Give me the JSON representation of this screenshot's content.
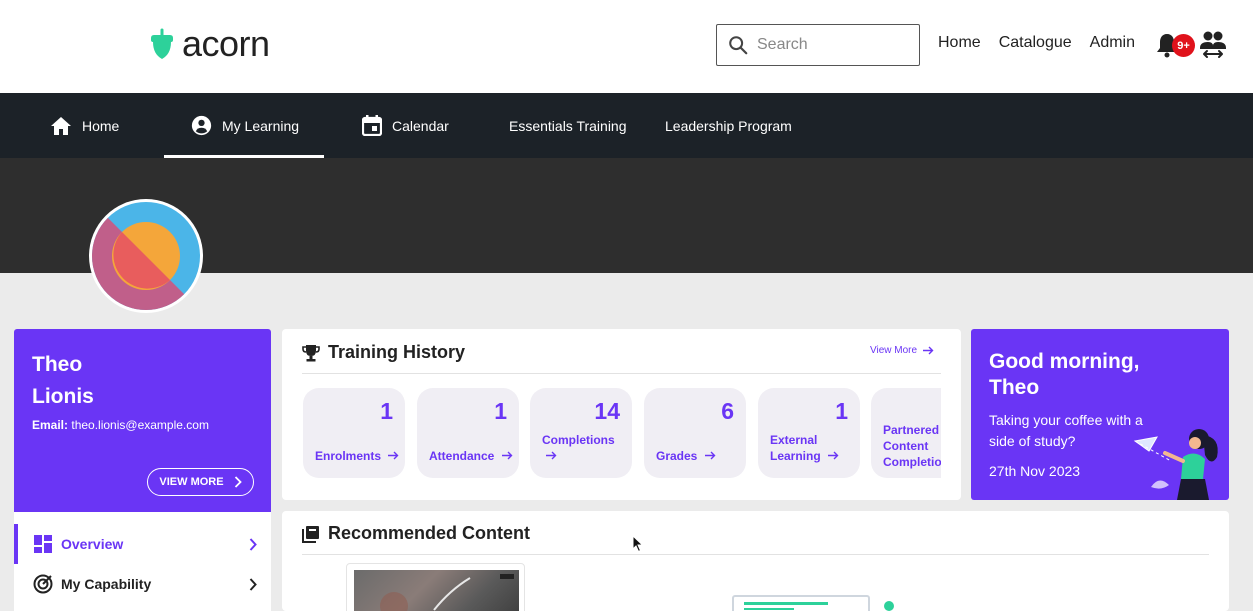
{
  "header": {
    "logo_text": "acorn",
    "search_placeholder": "Search",
    "links": [
      "Home",
      "Catalogue",
      "Admin"
    ],
    "notification_badge": "9+"
  },
  "nav": {
    "items": [
      {
        "label": "Home",
        "icon": "home-icon"
      },
      {
        "label": "My Learning",
        "icon": "account-circle-icon",
        "active": true
      },
      {
        "label": "Calendar",
        "icon": "calendar-icon"
      },
      {
        "label": "Essentials Training"
      },
      {
        "label": "Leadership Program"
      }
    ]
  },
  "profile": {
    "first_name": "Theo",
    "last_name": "Lionis",
    "email_label": "Email:",
    "email": "theo.lionis@example.com",
    "view_more_label": "VIEW MORE"
  },
  "side_menu": {
    "items": [
      {
        "label": "Overview",
        "icon": "dashboard-icon",
        "active": true
      },
      {
        "label": "My Capability",
        "icon": "target-icon"
      }
    ]
  },
  "training_history": {
    "title": "Training History",
    "view_more": "View More",
    "stats": [
      {
        "value": "1",
        "label": "Enrolments"
      },
      {
        "value": "1",
        "label": "Attendance"
      },
      {
        "value": "14",
        "label": "Completions"
      },
      {
        "value": "6",
        "label": "Grades"
      },
      {
        "value": "1",
        "label_line1": "External",
        "label_line2": "Learning"
      },
      {
        "value": "",
        "label_line1": "Partnered",
        "label_line2": "Content",
        "label_line3": "Completions"
      }
    ]
  },
  "greeting": {
    "title_line1": "Good morning,",
    "title_line2": "Theo",
    "subtitle": "Taking your coffee with a side of study?",
    "date": "27th Nov 2023"
  },
  "recommended": {
    "title": "Recommended Content"
  },
  "colors": {
    "accent": "#6a35f5",
    "nav_bg": "#1c2228",
    "banner_bg": "#2e2e2e",
    "badge": "#e0121b",
    "logo_green": "#2dd19a"
  }
}
